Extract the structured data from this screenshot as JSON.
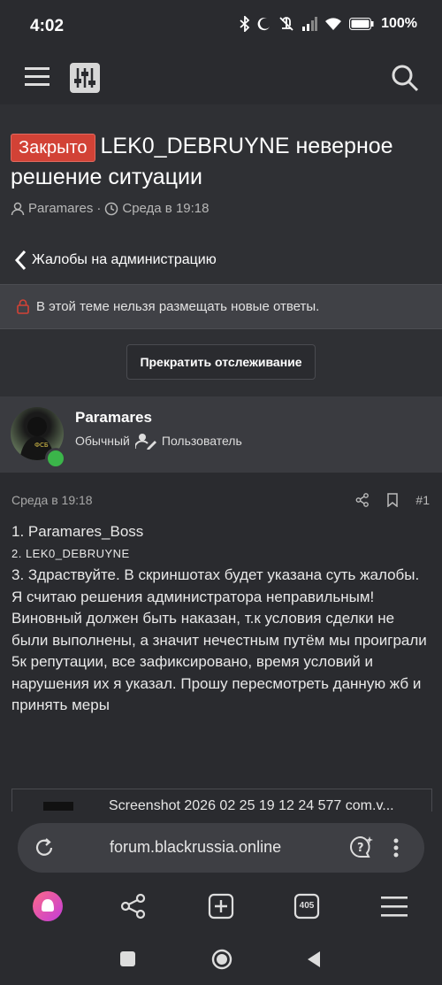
{
  "status_bar": {
    "time": "4:02",
    "battery": "100%"
  },
  "app_bar": {
    "menu_icon": "hamburger-icon",
    "logo_icon": "equalizer-logo-icon",
    "search_icon": "search-icon"
  },
  "thread": {
    "badge": "Закрыто",
    "title": "LEK0_DEBRUYNE неверное решение ситуации",
    "author": "Paramares",
    "date": "Среда в 19:18",
    "breadcrumb": "Жалобы на администрацию",
    "locked_notice": "В этой теме нельзя размещать новые ответы.",
    "unwatch_button": "Прекратить отслеживание"
  },
  "post": {
    "username": "Paramares",
    "rank": "Обычный",
    "role": "Пользователь",
    "date": "Среда в 19:18",
    "number": "#1",
    "lines": [
      "1. Paramares_Boss",
      "2. LEK0_DEBRUYNE",
      "3. Здраствуйте. В скриншотах будет указана суть жалобы.",
      "Я считаю решения администратора неправильным! Виновный должен быть наказан, т.к условия сделки не были выполнены, а значит нечестным путём мы проиграли 5к репутации, все зафиксировано, время условий и нарушения их я указал. Прошу пересмотреть данную жб и принять меры"
    ],
    "attachment_name": "Screenshot 2026 02 25 19 12 24 577 com.v..."
  },
  "browser": {
    "url": "forum.blackrussia.online",
    "tabs_count": "405"
  },
  "colors": {
    "badge_red": "#d24236",
    "online_green": "#3bb54a",
    "lock_red": "#d24236"
  }
}
